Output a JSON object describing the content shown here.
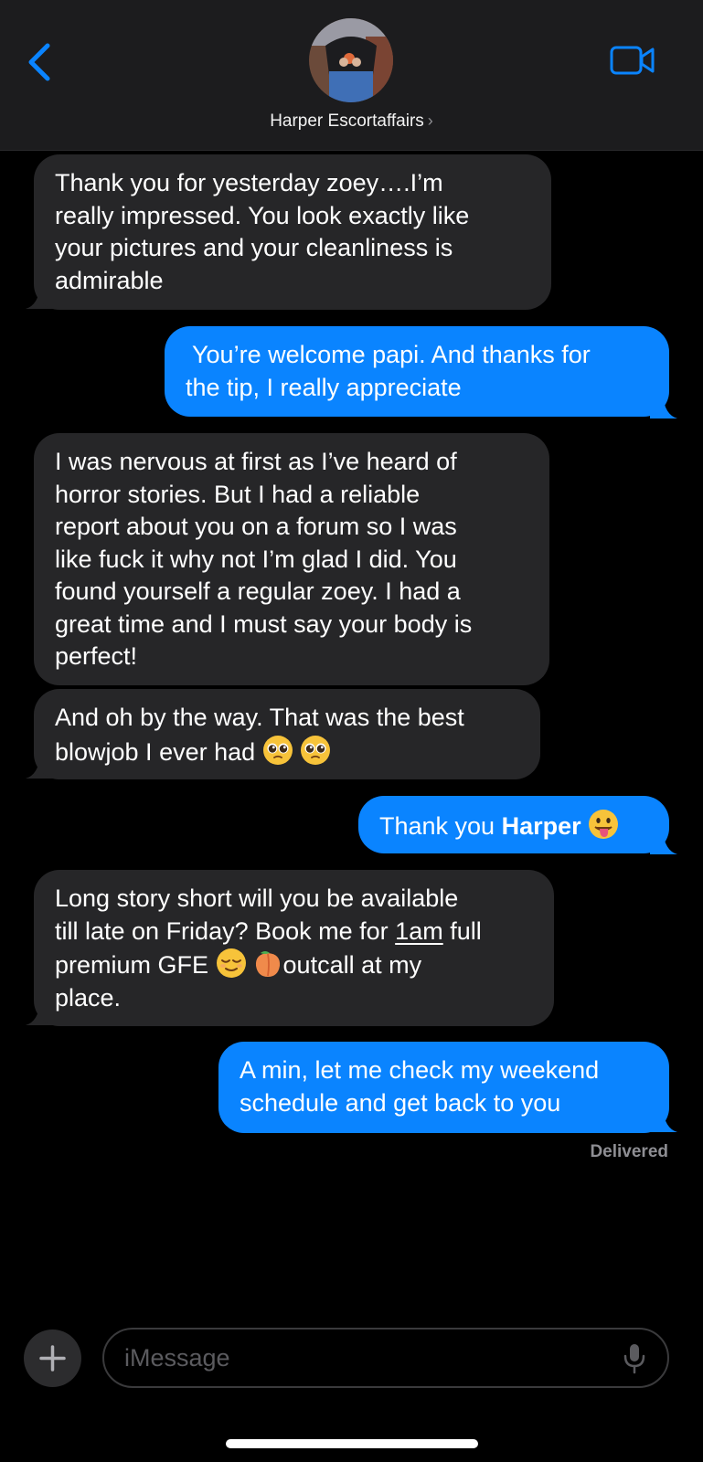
{
  "header": {
    "contact_name": "Harper Escortaffairs",
    "chevron": "›",
    "back_icon": "chevron-left-icon",
    "video_icon": "video-camera-icon",
    "accent_color": "#0a84ff"
  },
  "messages": [
    {
      "direction": "incoming",
      "lines": [
        "Thank you for yesterday zoey….I’m",
        "really impressed. You look exactly like",
        "your pictures and your cleanliness is",
        "admirable"
      ]
    },
    {
      "direction": "outgoing",
      "lines": [
        " You’re welcome papi. And thanks for",
        "the tip, I really appreciate"
      ]
    },
    {
      "direction": "incoming",
      "lines": [
        "I was nervous at first as I’ve heard of",
        "horror stories. But I had a reliable",
        "report about you on a forum so I was",
        "like fuck it why not I’m glad I did. You",
        "found yourself a regular zoey. I had a",
        "great time and I must say your body is",
        "perfect!"
      ]
    },
    {
      "direction": "incoming",
      "lines": [
        "And oh by the way. That was the best",
        "blowjob I ever had"
      ],
      "emojis": [
        "pleading-face-emoji",
        "pleading-face-emoji"
      ]
    },
    {
      "direction": "outgoing",
      "prefix": "Thank you ",
      "bold": "Harper",
      "emojis": [
        "tongue-out-face-emoji"
      ]
    },
    {
      "direction": "incoming",
      "line1": "Long story short will you be available",
      "line2_pre": "till late on Friday? Book me for ",
      "line2_link": "1am",
      "line2_post": " full",
      "line3_pre": "premium GFE ",
      "line3_post": "outcall at my",
      "line4": "place.",
      "emojis": [
        "relieved-face-emoji",
        "peach-emoji"
      ]
    },
    {
      "direction": "outgoing",
      "lines": [
        "A min, let me check my weekend",
        "schedule and get back to you"
      ]
    }
  ],
  "status": {
    "delivered": "Delivered"
  },
  "composer": {
    "placeholder": "iMessage",
    "plus_icon": "plus-icon",
    "mic_icon": "microphone-icon"
  }
}
